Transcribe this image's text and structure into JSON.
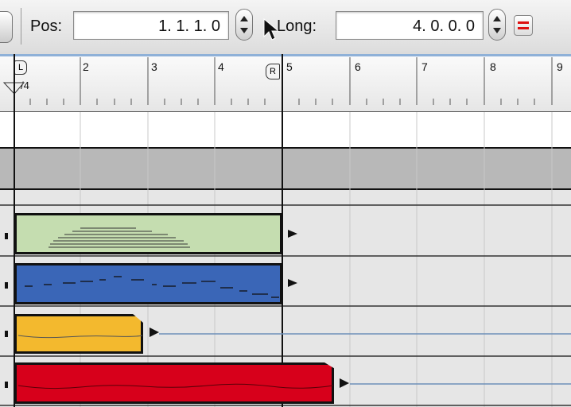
{
  "toolbar": {
    "pos_label": "Pos:",
    "pos_value": "1.  1.  1.    0",
    "length_label": "Long:",
    "length_value": "4.  0.  0.    0"
  },
  "ruler": {
    "bars": [
      "2",
      "3",
      "4",
      "5",
      "6",
      "7",
      "8",
      "9"
    ],
    "time_signature": "/4",
    "left_locator": "L",
    "right_locator": "R"
  },
  "colors": {
    "green_region": "#c5ddb0",
    "blue_region": "#3a66b7",
    "yellow_region": "#f3b92e",
    "red_region": "#d7001b",
    "grey_lane": "#b8b8b8"
  }
}
